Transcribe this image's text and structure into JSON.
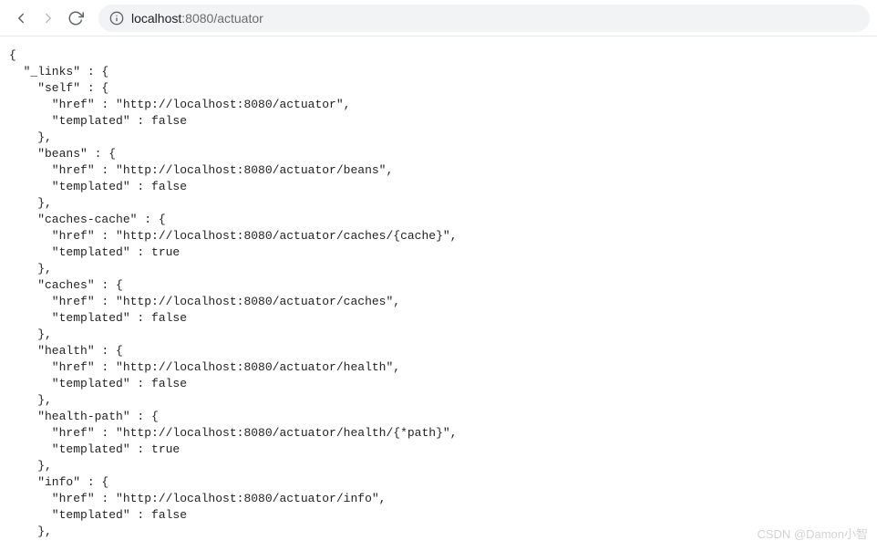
{
  "toolbar": {
    "url_host": "localhost",
    "url_port": ":8080",
    "url_path": "/actuator"
  },
  "response": {
    "open_brace": "{",
    "links_key": "  \"_links\" : {",
    "entries": [
      {
        "key": "self",
        "href": "http://localhost:8080/actuator",
        "templated": "false"
      },
      {
        "key": "beans",
        "href": "http://localhost:8080/actuator/beans",
        "templated": "false"
      },
      {
        "key": "caches-cache",
        "href": "http://localhost:8080/actuator/caches/{cache}",
        "templated": "true"
      },
      {
        "key": "caches",
        "href": "http://localhost:8080/actuator/caches",
        "templated": "false"
      },
      {
        "key": "health",
        "href": "http://localhost:8080/actuator/health",
        "templated": "false"
      },
      {
        "key": "health-path",
        "href": "http://localhost:8080/actuator/health/{*path}",
        "templated": "true"
      },
      {
        "key": "info",
        "href": "http://localhost:8080/actuator/info",
        "templated": "false"
      }
    ]
  },
  "watermark": "CSDN @Damon小智"
}
